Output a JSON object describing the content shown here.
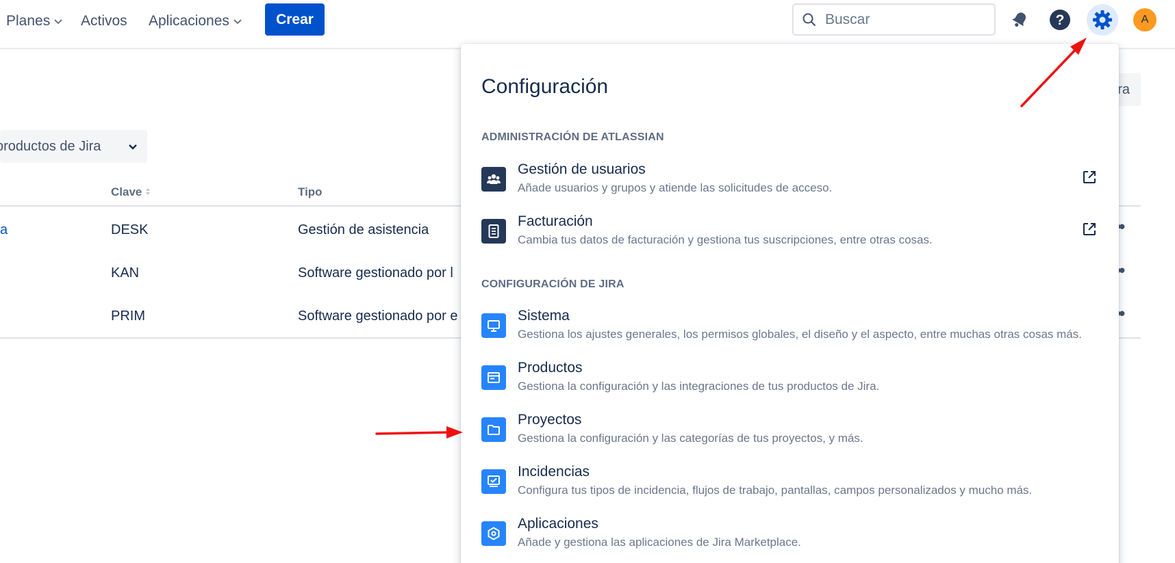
{
  "nav": {
    "planes": "Planes",
    "activos": "Activos",
    "aplicaciones": "Aplicaciones",
    "crear": "Crear",
    "search_placeholder": "Buscar",
    "avatar_initial": "A"
  },
  "page": {
    "filter_label": "productos de Jira",
    "right_button": "ra",
    "columns": {
      "clave": "Clave",
      "tipo": "Tipo"
    },
    "rows": [
      {
        "name": "a",
        "key": "DESK",
        "type": "Gestión de asistencia"
      },
      {
        "name": "",
        "key": "KAN",
        "type": "Software gestionado por l"
      },
      {
        "name": "",
        "key": "PRIM",
        "type": "Software gestionado por e"
      }
    ]
  },
  "settings": {
    "title": "Configuración",
    "sections": [
      {
        "heading": "ADMINISTRACIÓN DE ATLASSIAN",
        "items": [
          {
            "title": "Gestión de usuarios",
            "desc": "Añade usuarios y grupos y atiende las solicitudes de acceso.",
            "icon": "users-icon"
          },
          {
            "title": "Facturación",
            "desc": "Cambia tus datos de facturación y gestiona tus suscripciones, entre otras cosas.",
            "icon": "billing-icon"
          }
        ]
      },
      {
        "heading": "CONFIGURACIÓN DE JIRA",
        "items": [
          {
            "title": "Sistema",
            "desc": "Gestiona los ajustes generales, los permisos globales, el diseño y el aspecto, entre muchas otras cosas más.",
            "icon": "monitor-icon"
          },
          {
            "title": "Productos",
            "desc": "Gestiona la configuración y las integraciones de tus productos de Jira.",
            "icon": "window-icon"
          },
          {
            "title": "Proyectos",
            "desc": "Gestiona la configuración y las categorías de tus proyectos, y más.",
            "icon": "folder-icon"
          },
          {
            "title": "Incidencias",
            "desc": "Configura tus tipos de incidencia, flujos de trabajo, pantallas, campos personalizados y mucho más.",
            "icon": "issue-icon"
          },
          {
            "title": "Aplicaciones",
            "desc": "Añade y gestiona las aplicaciones de Jira Marketplace.",
            "icon": "apps-icon"
          }
        ]
      }
    ]
  },
  "colors": {
    "primary": "#0052cc",
    "icon_blue": "#2684ff",
    "icon_dark": "#253858",
    "annotation_red": "#ee1111",
    "avatar": "#ff991f"
  }
}
